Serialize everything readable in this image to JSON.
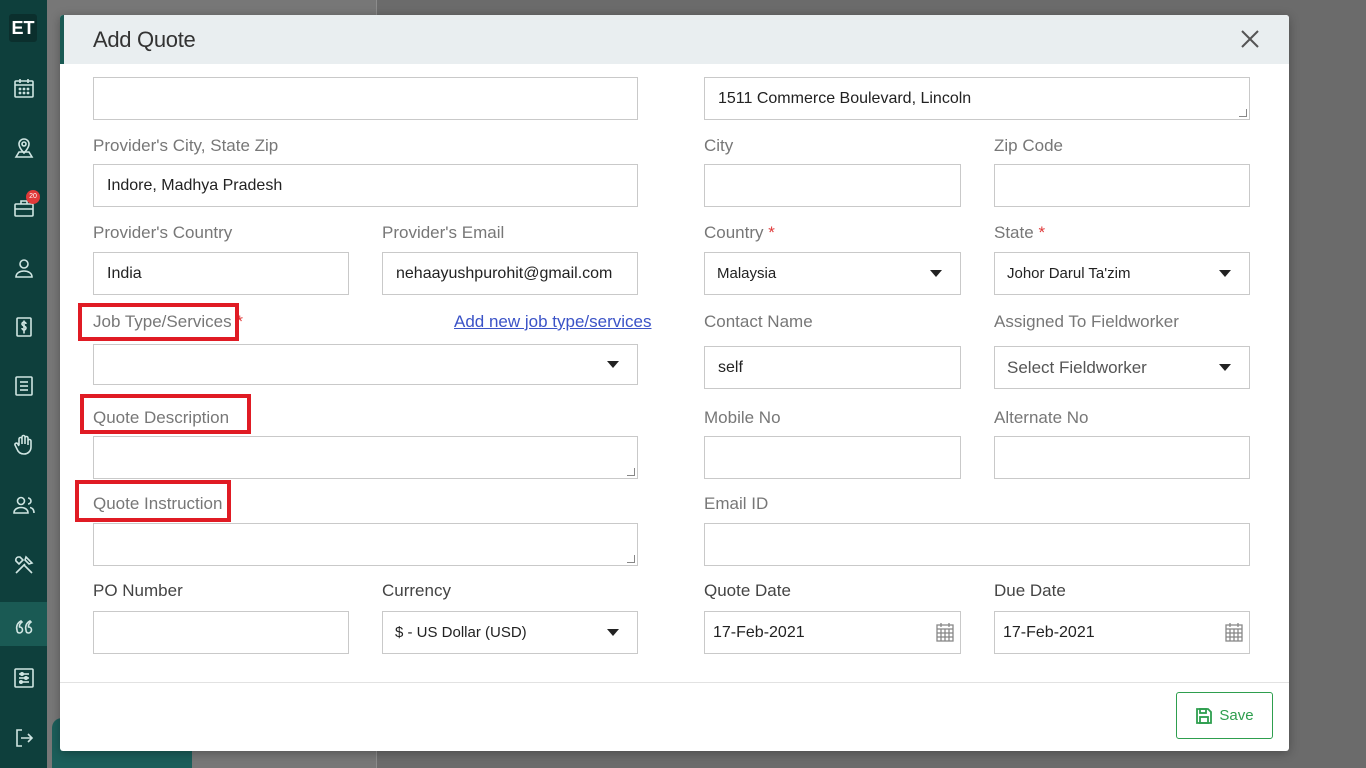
{
  "sidebar": {
    "logo": "ET",
    "badge_count": "20",
    "items": [
      "calendar-icon",
      "map-pin-icon",
      "briefcase-icon",
      "user-icon",
      "dollar-icon",
      "list-icon",
      "hand-icon",
      "users-icon",
      "tools-icon",
      "quote-icon",
      "sliders-icon",
      "logout-icon"
    ]
  },
  "modal": {
    "title": "Add Quote",
    "footer": {
      "save_label": "Save"
    }
  },
  "form": {
    "provider_address": {
      "value": ""
    },
    "address": {
      "value": "1511  Commerce Boulevard, Lincoln"
    },
    "provider_city_state_zip": {
      "label": "Provider's City, State Zip",
      "value": "Indore, Madhya Pradesh"
    },
    "city": {
      "label": "City",
      "value": ""
    },
    "zip_code": {
      "label": "Zip Code",
      "value": ""
    },
    "provider_country": {
      "label": "Provider's Country",
      "value": "India"
    },
    "provider_email": {
      "label": "Provider's Email",
      "value": "nehaayushpurohit@gmail.com"
    },
    "country": {
      "label": "Country",
      "required": "*",
      "value": "Malaysia"
    },
    "state": {
      "label": "State",
      "required": "*",
      "value": "Johor Darul Ta'zim"
    },
    "job_type": {
      "label": "Job Type/Services",
      "required": "*",
      "value": "",
      "add_link": "Add new job type/services"
    },
    "contact_name": {
      "label": "Contact Name",
      "value": "self"
    },
    "assigned_to": {
      "label": "Assigned To Fieldworker",
      "value": "Select Fieldworker"
    },
    "quote_description": {
      "label": "Quote Description",
      "value": ""
    },
    "mobile_no": {
      "label": "Mobile No",
      "value": ""
    },
    "alternate_no": {
      "label": "Alternate No",
      "value": ""
    },
    "quote_instruction": {
      "label": "Quote Instruction",
      "value": ""
    },
    "email_id": {
      "label": "Email ID",
      "value": ""
    },
    "po_number": {
      "label": "PO Number",
      "value": ""
    },
    "currency": {
      "label": "Currency",
      "value": "$ - US Dollar (USD)"
    },
    "quote_date": {
      "label": "Quote Date",
      "value": "17-Feb-2021"
    },
    "due_date": {
      "label": "Due Date",
      "value": "17-Feb-2021"
    }
  },
  "colors": {
    "sidebar": "#0e3f3c",
    "highlight": "#e01b24",
    "link": "#3b53c7",
    "save": "#2e9e4e",
    "required": "#e03a3a"
  }
}
